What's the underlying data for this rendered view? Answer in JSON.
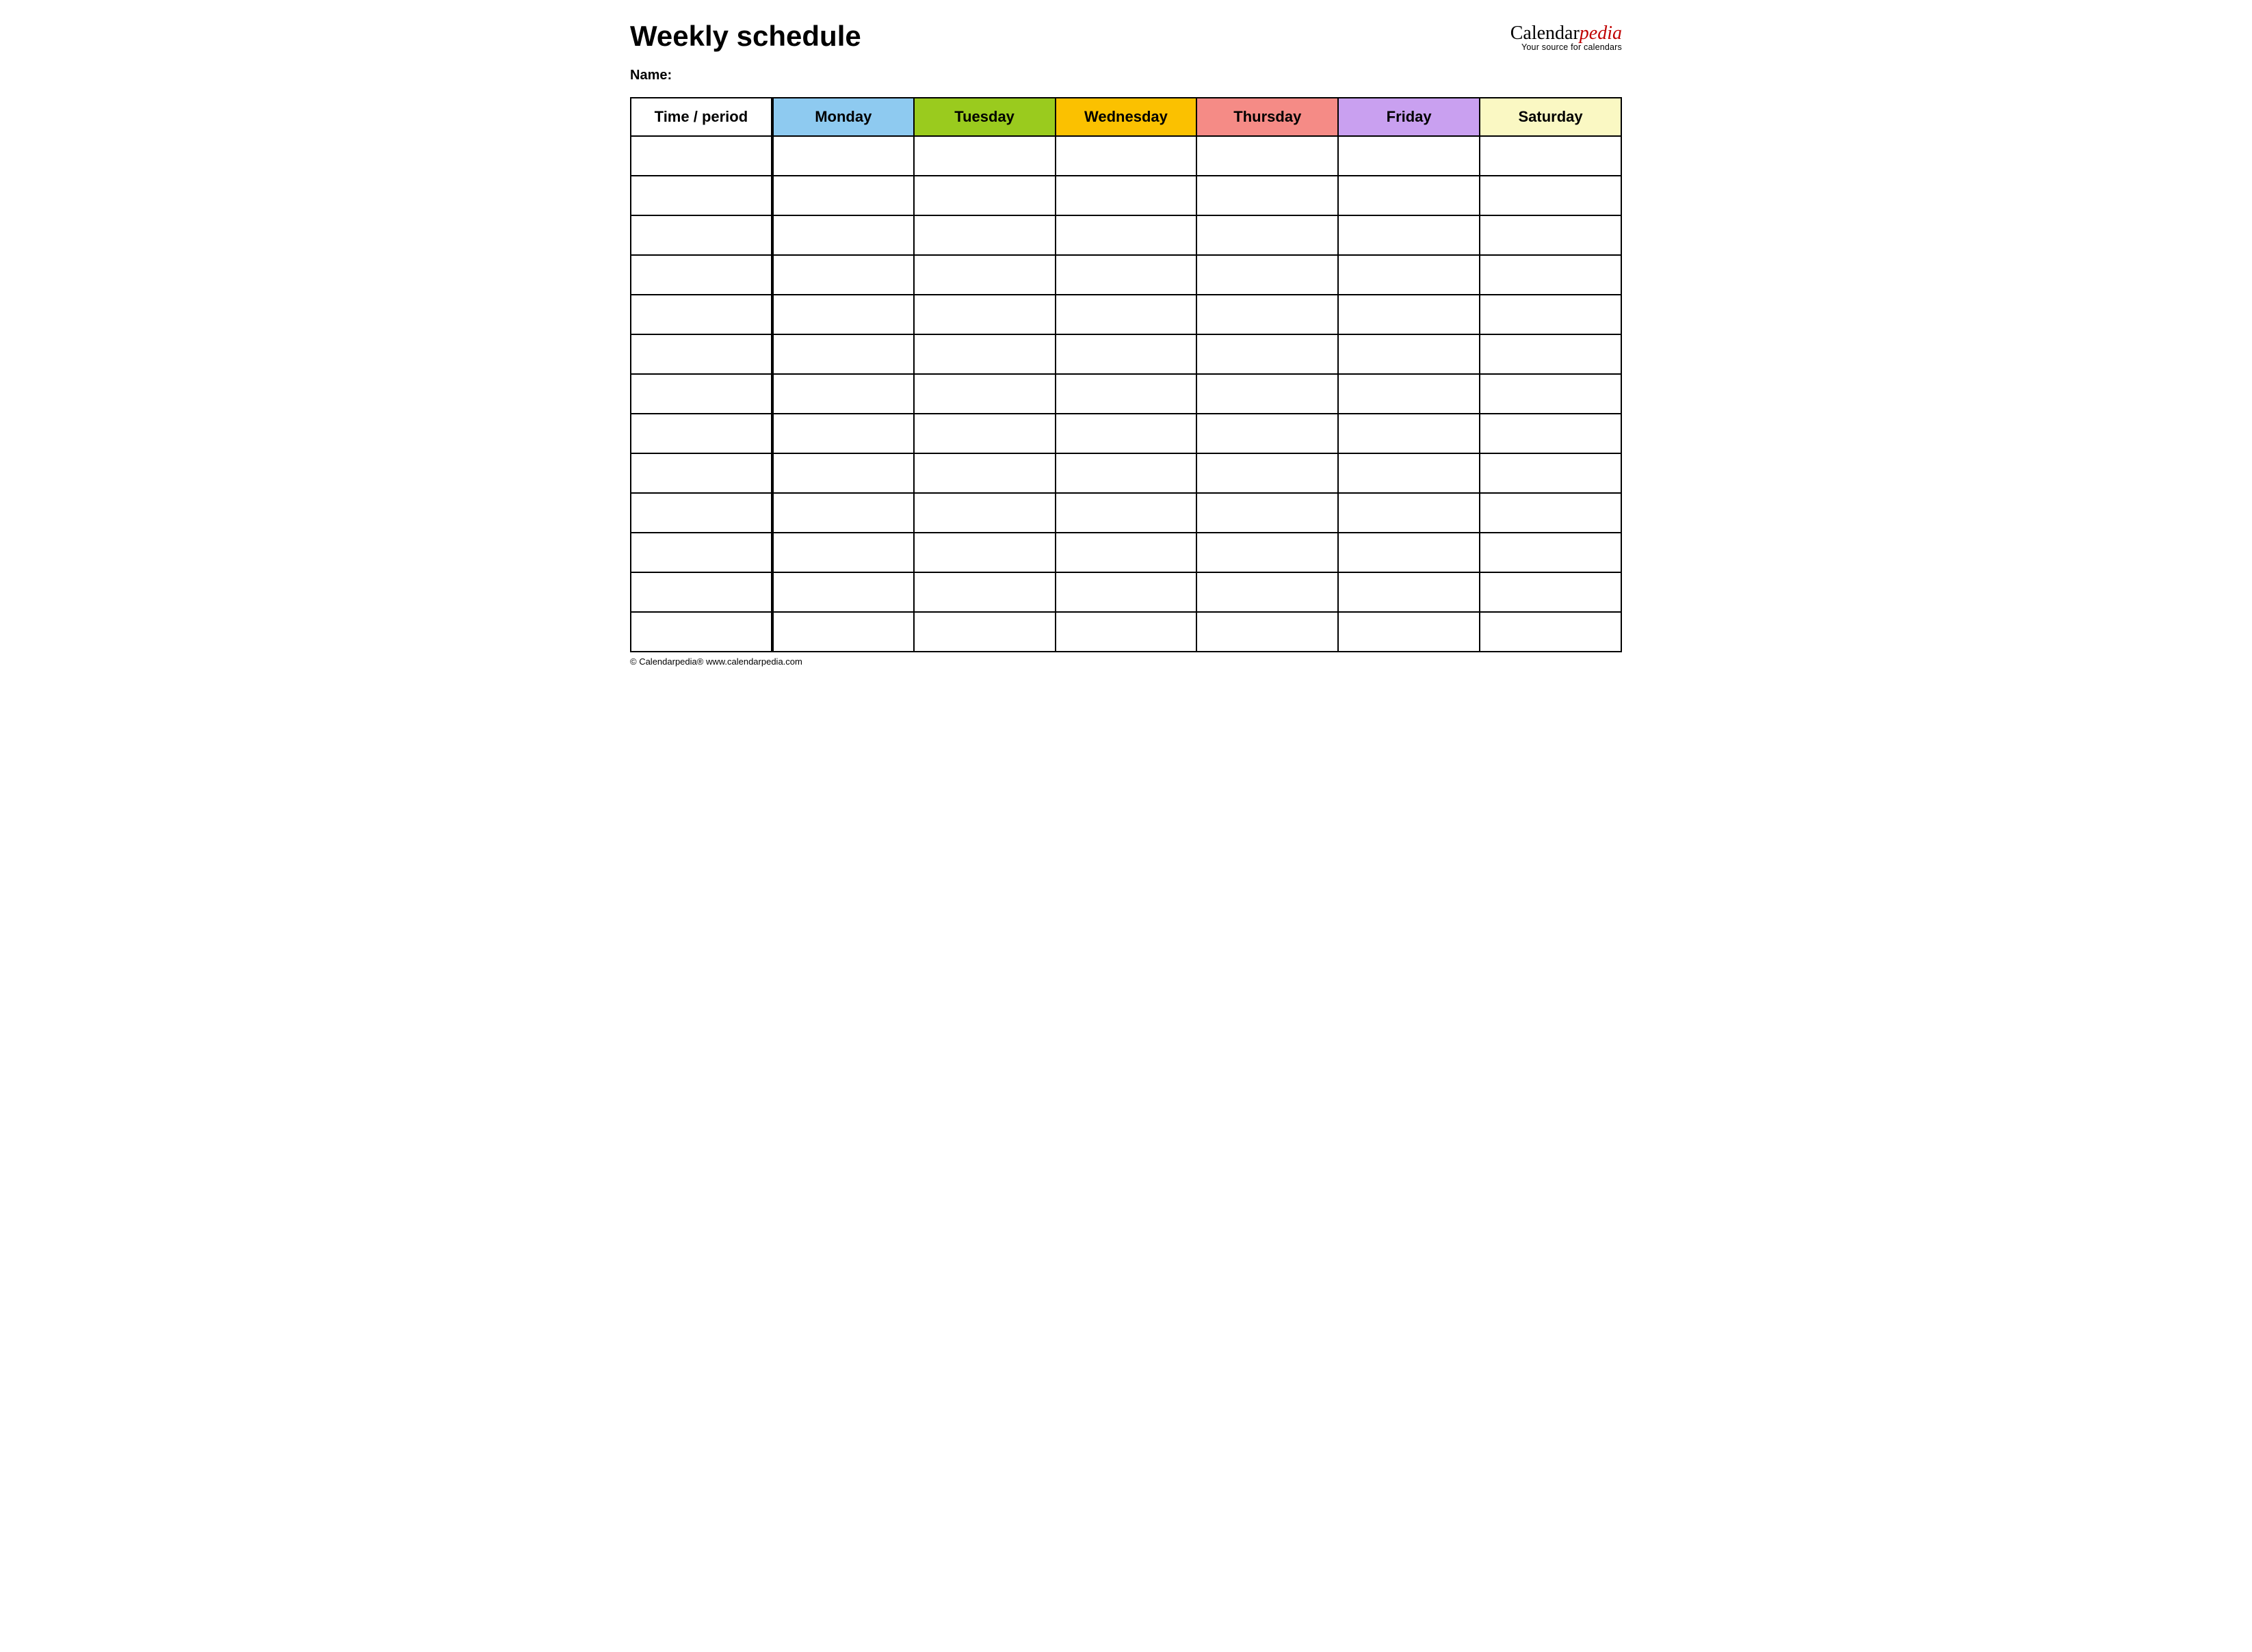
{
  "header": {
    "title": "Weekly schedule",
    "name_label": "Name:"
  },
  "brand": {
    "part1": "Calendar",
    "part2": "pedia",
    "tagline": "Your source for calendars"
  },
  "table": {
    "columns": [
      {
        "label": "Time / period",
        "color": "#ffffff"
      },
      {
        "label": "Monday",
        "color": "#8ecaf0"
      },
      {
        "label": "Tuesday",
        "color": "#9acb1e"
      },
      {
        "label": "Wednesday",
        "color": "#fbc100"
      },
      {
        "label": "Thursday",
        "color": "#f58b86"
      },
      {
        "label": "Friday",
        "color": "#c9a0f0"
      },
      {
        "label": "Saturday",
        "color": "#faf8c3"
      }
    ],
    "row_count": 13
  },
  "footer": {
    "copyright": "© Calendarpedia®   www.calendarpedia.com"
  }
}
